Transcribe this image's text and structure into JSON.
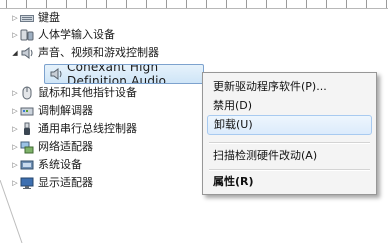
{
  "tree": {
    "items": [
      {
        "label": "键盘",
        "expanded": false,
        "icon": "keyboard-icon"
      },
      {
        "label": "人体学输入设备",
        "expanded": false,
        "icon": "hid-icon"
      },
      {
        "label": "声音、视频和游戏控制器",
        "expanded": true,
        "icon": "speaker-icon"
      },
      {
        "label": "Conexant High Definition Audio",
        "selected": true,
        "icon": "speaker-icon"
      },
      {
        "label": "鼠标和其他指针设备",
        "expanded": false,
        "icon": "mouse-icon"
      },
      {
        "label": "调制解调器",
        "expanded": false,
        "icon": "modem-icon"
      },
      {
        "label": "通用串行总线控制器",
        "expanded": false,
        "icon": "usb-icon"
      },
      {
        "label": "网络适配器",
        "expanded": false,
        "icon": "network-icon"
      },
      {
        "label": "系统设备",
        "expanded": false,
        "icon": "system-icon"
      },
      {
        "label": "显示适配器",
        "expanded": false,
        "icon": "display-icon"
      }
    ]
  },
  "context_menu": {
    "items": [
      {
        "label": "更新驱动程序软件(P)..."
      },
      {
        "label": "禁用(D)"
      },
      {
        "label": "卸载(U)",
        "highlighted": true
      },
      {
        "label": "扫描检测硬件改动(A)"
      },
      {
        "label": "属性(R)",
        "bold": true
      }
    ]
  },
  "colors": {
    "selection": "#cfe5f7",
    "menu_background": "#f4f4f4",
    "menu_hover": "#dcebfc"
  }
}
